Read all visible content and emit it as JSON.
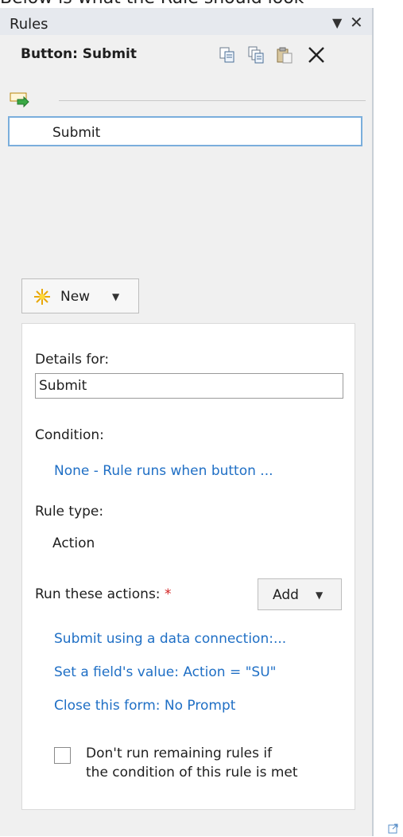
{
  "caption": "Below is what the Rule should look",
  "pane": {
    "title": "Rules",
    "menu_glyph": "▼",
    "close_glyph": "✕"
  },
  "control_label": "Button: Submit",
  "rules": [
    {
      "name": "Submit"
    }
  ],
  "new_button": {
    "label": "New",
    "caret": "▼"
  },
  "details": {
    "details_for_label": "Details for:",
    "rule_name_value": "Submit",
    "condition_label": "Condition:",
    "condition_link": "None - Rule runs when button ...",
    "rule_type_label": "Rule type:",
    "rule_type_value": "Action",
    "run_actions_label": "Run these actions:",
    "required_marker": "*",
    "add_button": {
      "label": "Add",
      "caret": "▼"
    },
    "actions": [
      "Submit using a data connection:...",
      "Set a field's value: Action = \"SU\"",
      "Close this form: No Prompt"
    ],
    "checkbox": {
      "checked": false,
      "label_line1": "Don't run remaining rules if",
      "label_line2": "the condition of this rule is met"
    }
  },
  "colors": {
    "link": "#1f6fc5",
    "selection_border": "#7aaedc",
    "pane_bg": "#f0f0f0"
  }
}
